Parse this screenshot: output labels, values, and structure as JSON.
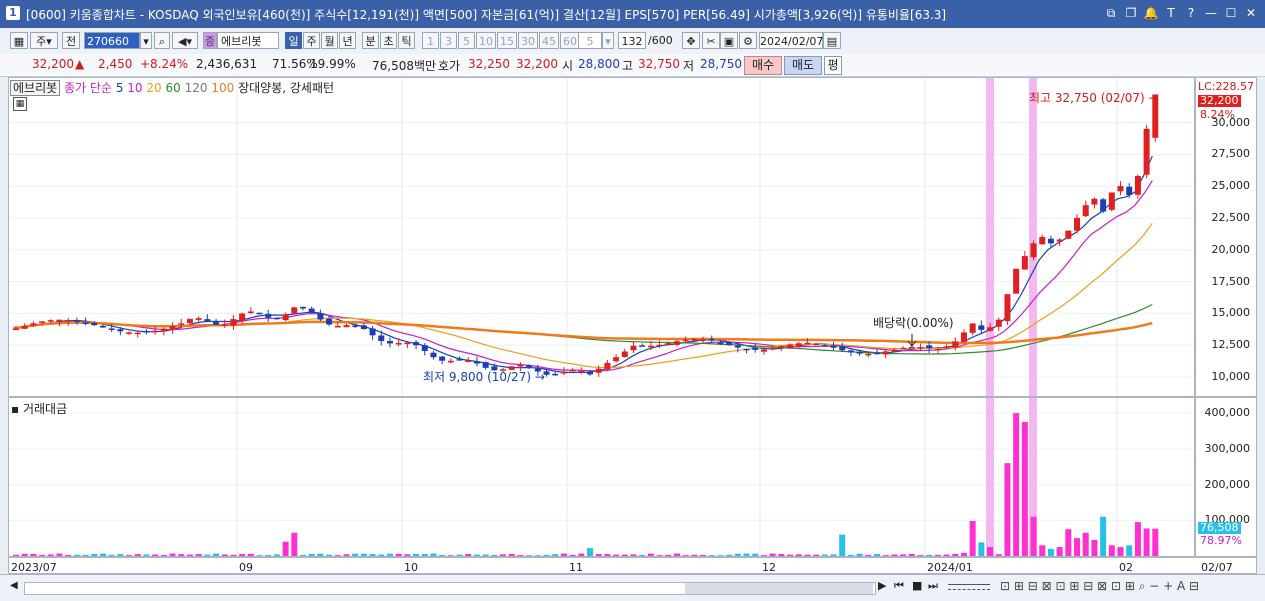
{
  "window": {
    "app_no": "1",
    "title": "[0600] 키움종합차트 - KOSDAQ 외국인보유[460(천)] 주식수[12,191(천)] 액면[500] 자본금[61(억)] 결산[12월] EPS[570] PER[56.49] 시가총액[3,926(억)] 유통비율[63.3]",
    "icons": [
      "restore-icon",
      "window-icon",
      "bell-icon",
      "text-icon",
      "help-icon",
      "minimize-icon",
      "maximize-icon",
      "close-icon"
    ],
    "icon_glyphs": [
      "⧉",
      "❐",
      "🔔",
      "T",
      "?",
      "—",
      "☐",
      "✕"
    ]
  },
  "toolbar": {
    "period_unit": "주",
    "prev_label": "전",
    "code": "270660",
    "stock_badge": "증",
    "stock_name": "에브리봇",
    "periods": [
      "일",
      "주",
      "월",
      "년",
      "분",
      "초",
      "틱"
    ],
    "active_period": "일",
    "minutes": [
      "1",
      "3",
      "5",
      "10",
      "15",
      "30",
      "45",
      "60"
    ],
    "custom_value": "5",
    "count": "132",
    "count_total": "/600",
    "date": "2024/02/07"
  },
  "quote": {
    "price": "32,200",
    "arrow": "▲",
    "change": "2,450",
    "change_pct": "+8.24%",
    "volume": "2,436,631",
    "vol_ratio": "71.56%",
    "turnover": "19.99%",
    "amount": "76,508백만",
    "ask_label": "호가",
    "ask": "32,250",
    "bid": "32,200",
    "open_label": "시",
    "open": "28,800",
    "high_label": "고",
    "high": "32,750",
    "low_label": "저",
    "low": "28,750",
    "buy_label": "매수",
    "sell_label": "매도",
    "eval_label": "평"
  },
  "legend": {
    "stock": "에브리봇",
    "ma_prefix": "종가 단순",
    "ma_periods": [
      "5",
      "10",
      "20",
      "60",
      "120",
      "100"
    ],
    "pattern": "장대양봉, 강세패턴",
    "volume_title": "거래대금"
  },
  "colors": {
    "up": "#e02020",
    "down": "#1b3fb5",
    "ma5": "#1b3fb5",
    "ma10": "#c81fc8",
    "ma20": "#e8a020",
    "ma60": "#2e8b2e",
    "ma120": "#7a7a7a",
    "ma100": "#f07a1a",
    "vol_up": "#ff2fd0",
    "vol_down": "#28c0e8",
    "highlight": "#f4b8f0"
  },
  "price_axis": {
    "lc_label": "LC:228.57",
    "price_badge": "32,200",
    "pct_badge": "8.24%",
    "ticks": [
      "30,000",
      "27,500",
      "25,000",
      "22,500",
      "20,000",
      "17,500",
      "15,000",
      "12,500",
      "10,000"
    ]
  },
  "volume_axis": {
    "ticks": [
      "400,000",
      "300,000",
      "200,000",
      "100,000"
    ],
    "value_badge": "76,508",
    "pct_badge": "78.97%"
  },
  "x_axis": {
    "labels": [
      "2023/07",
      "09",
      "10",
      "11",
      "12",
      "2024/01",
      "02",
      "02/07"
    ]
  },
  "annotations": {
    "high": "최고 32,750 (02/07)",
    "low": "최저 9,800 (10/27)",
    "dividend": "배당락(0.00%)"
  },
  "chart_data": {
    "type": "candlestick",
    "price_ylim": [
      8500,
      33500
    ],
    "volume_ylim": [
      0,
      420000
    ],
    "start_price": 13800,
    "ohlc_segments": [
      {
        "from": "2023/06",
        "to": "2023/08",
        "close_range": [
          12500,
          15500
        ]
      },
      {
        "from": "2023/09",
        "to": "2023/09",
        "close_range": [
          14000,
          16000
        ]
      },
      {
        "from": "2023/10",
        "to": "2023/10",
        "close_range": [
          9800,
          13000
        ]
      },
      {
        "from": "2023/11",
        "to": "2023/12",
        "close_range": [
          11500,
          13500
        ]
      },
      {
        "from": "2024/01",
        "to": "2024/02/07",
        "close_range": [
          12000,
          32200
        ]
      }
    ],
    "last_candle": {
      "date": "02/07",
      "open": 28800,
      "high": 32750,
      "low": 28750,
      "close": 32200
    },
    "highlight_days": [
      "2024/01 spike 1",
      "2024/01 spike 2"
    ]
  },
  "bottom": {
    "buttons": [
      "▶",
      "⏮",
      "■",
      "⏭"
    ],
    "tools": [
      "zoom-out",
      "zoom-in",
      "text-tool"
    ]
  }
}
